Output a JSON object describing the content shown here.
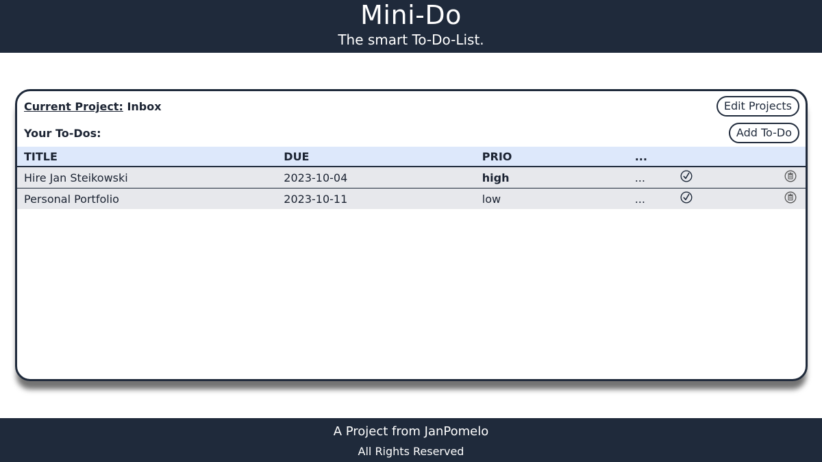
{
  "header": {
    "title": "Mini-Do",
    "subtitle": "The smart To-Do-List."
  },
  "project": {
    "label": "Current Project:",
    "name": "Inbox",
    "edit_button": "Edit Projects"
  },
  "todos": {
    "section_label": "Your To-Dos:",
    "add_button": "Add To-Do",
    "columns": [
      "TITLE",
      "DUE",
      "PRIO",
      "..."
    ],
    "rows": [
      {
        "title": "Hire Jan Steikowski",
        "due": "2023-10-04",
        "prio": "high",
        "more": "..."
      },
      {
        "title": "Personal Portfolio",
        "due": "2023-10-11",
        "prio": "low",
        "more": "..."
      }
    ]
  },
  "footer": {
    "line1": "A Project from JanPomelo",
    "line2": "All Rights Reserved"
  },
  "icons": {
    "check": "check-circle-icon",
    "delete": "trash-icon"
  },
  "colors": {
    "navy": "#1f2a3b",
    "header_row": "#dde8fb",
    "body_row": "#e7e8ec"
  }
}
